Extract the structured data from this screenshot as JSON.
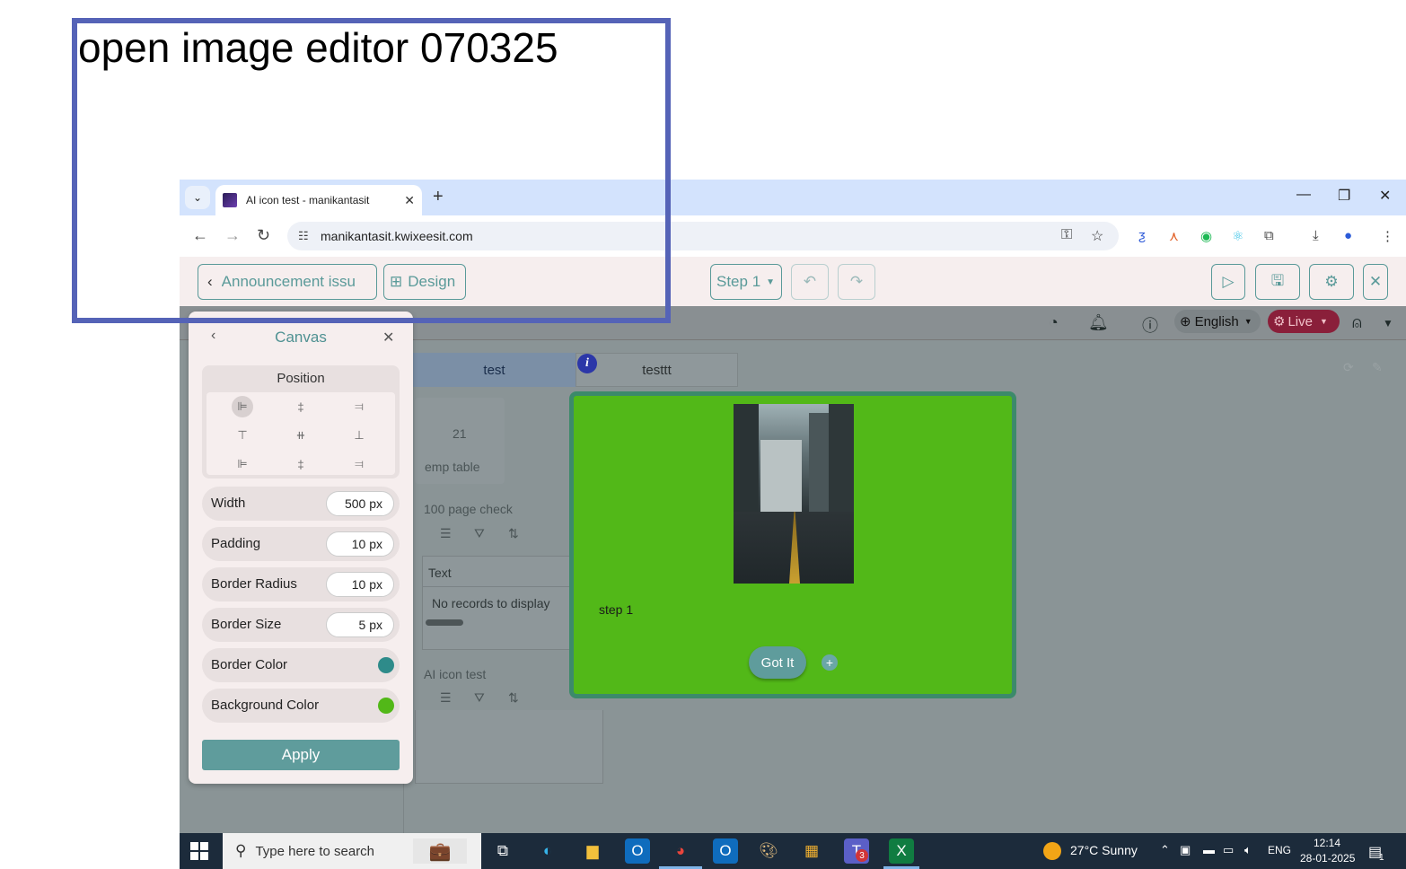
{
  "annotation": {
    "caption": "open image editor 070325"
  },
  "browser": {
    "tab_title": "AI icon test - manikantasit",
    "url": "manikantasit.kwixeesit.com"
  },
  "toolbar": {
    "back_label": "Announcement issu",
    "design_label": "Design",
    "step_label": "Step 1"
  },
  "topbar": {
    "language": "English",
    "live_label": "Live"
  },
  "tabs": [
    {
      "label": "test"
    },
    {
      "label": "testtt"
    }
  ],
  "background": {
    "count": "21",
    "emp_table": "emp table",
    "page_check": "100 page check",
    "column_header": "Text",
    "no_records": "No records to display",
    "ai_icon_test": "AI icon test"
  },
  "canvas_panel": {
    "title": "Canvas",
    "position_title": "Position",
    "props": [
      {
        "label": "Width",
        "value": "500 px"
      },
      {
        "label": "Padding",
        "value": "10 px"
      },
      {
        "label": "Border Radius",
        "value": "10 px"
      },
      {
        "label": "Border Size",
        "value": "5 px"
      },
      {
        "label": "Border Color",
        "color": "#2e8b8a"
      },
      {
        "label": "Background Color",
        "color": "#52b818"
      }
    ],
    "apply_label": "Apply"
  },
  "popup": {
    "step_text": "step 1",
    "button_label": "Got It",
    "background_color": "#52b818",
    "border_color": "#3c8a6a"
  },
  "taskbar": {
    "search_placeholder": "Type here to search",
    "weather": "27°C  Sunny",
    "lang": "ENG",
    "time": "12:14",
    "date": "28-01-2025",
    "teams_badge": "3",
    "notif_badge": "1"
  }
}
